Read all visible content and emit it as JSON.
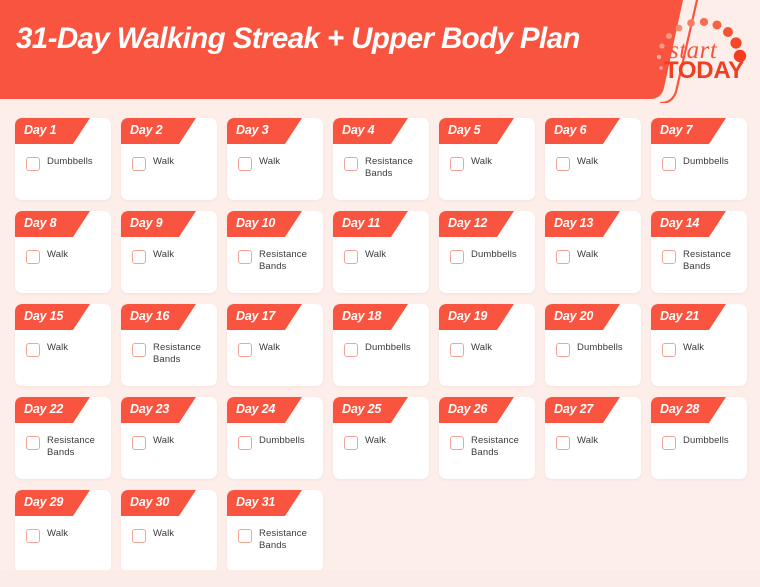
{
  "header": {
    "title": "31-Day Walking Streak + Upper Body Plan",
    "logo": {
      "start_text": "start",
      "today_text": "TODAY",
      "arc_icon": "dotted-arc-icon"
    },
    "colors": {
      "banner": "#f9543f",
      "page_background": "#fdeeea",
      "footer_strip": "#fcece8"
    }
  },
  "plan": {
    "day_prefix": "Day",
    "cards": [
      {
        "day": "Day 1",
        "task": "Dumbbells",
        "checked": false
      },
      {
        "day": "Day 2",
        "task": "Walk",
        "checked": false
      },
      {
        "day": "Day 3",
        "task": "Walk",
        "checked": false
      },
      {
        "day": "Day 4",
        "task": "Resistance Bands",
        "checked": false
      },
      {
        "day": "Day 5",
        "task": "Walk",
        "checked": false
      },
      {
        "day": "Day 6",
        "task": "Walk",
        "checked": false
      },
      {
        "day": "Day 7",
        "task": "Dumbbells",
        "checked": false
      },
      {
        "day": "Day 8",
        "task": "Walk",
        "checked": false
      },
      {
        "day": "Day 9",
        "task": "Walk",
        "checked": false
      },
      {
        "day": "Day 10",
        "task": "Resistance Bands",
        "checked": false
      },
      {
        "day": "Day 11",
        "task": "Walk",
        "checked": false
      },
      {
        "day": "Day 12",
        "task": "Dumbbells",
        "checked": false
      },
      {
        "day": "Day 13",
        "task": "Walk",
        "checked": false
      },
      {
        "day": "Day 14",
        "task": "Resistance Bands",
        "checked": false
      },
      {
        "day": "Day 15",
        "task": "Walk",
        "checked": false
      },
      {
        "day": "Day 16",
        "task": "Resistance Bands",
        "checked": false
      },
      {
        "day": "Day 17",
        "task": "Walk",
        "checked": false
      },
      {
        "day": "Day 18",
        "task": "Dumbbells",
        "checked": false
      },
      {
        "day": "Day 19",
        "task": "Walk",
        "checked": false
      },
      {
        "day": "Day 20",
        "task": "Dumbbells",
        "checked": false
      },
      {
        "day": "Day 21",
        "task": "Walk",
        "checked": false
      },
      {
        "day": "Day 22",
        "task": "Resistance Bands",
        "checked": false
      },
      {
        "day": "Day 23",
        "task": "Walk",
        "checked": false
      },
      {
        "day": "Day 24",
        "task": "Dumbbells",
        "checked": false
      },
      {
        "day": "Day 25",
        "task": "Walk",
        "checked": false
      },
      {
        "day": "Day 26",
        "task": "Resistance Bands",
        "checked": false
      },
      {
        "day": "Day 27",
        "task": "Walk",
        "checked": false
      },
      {
        "day": "Day 28",
        "task": "Dumbbells",
        "checked": false
      },
      {
        "day": "Day 29",
        "task": "Walk",
        "checked": false
      },
      {
        "day": "Day 30",
        "task": "Walk",
        "checked": false
      },
      {
        "day": "Day 31",
        "task": "Resistance Bands",
        "checked": false
      }
    ]
  }
}
